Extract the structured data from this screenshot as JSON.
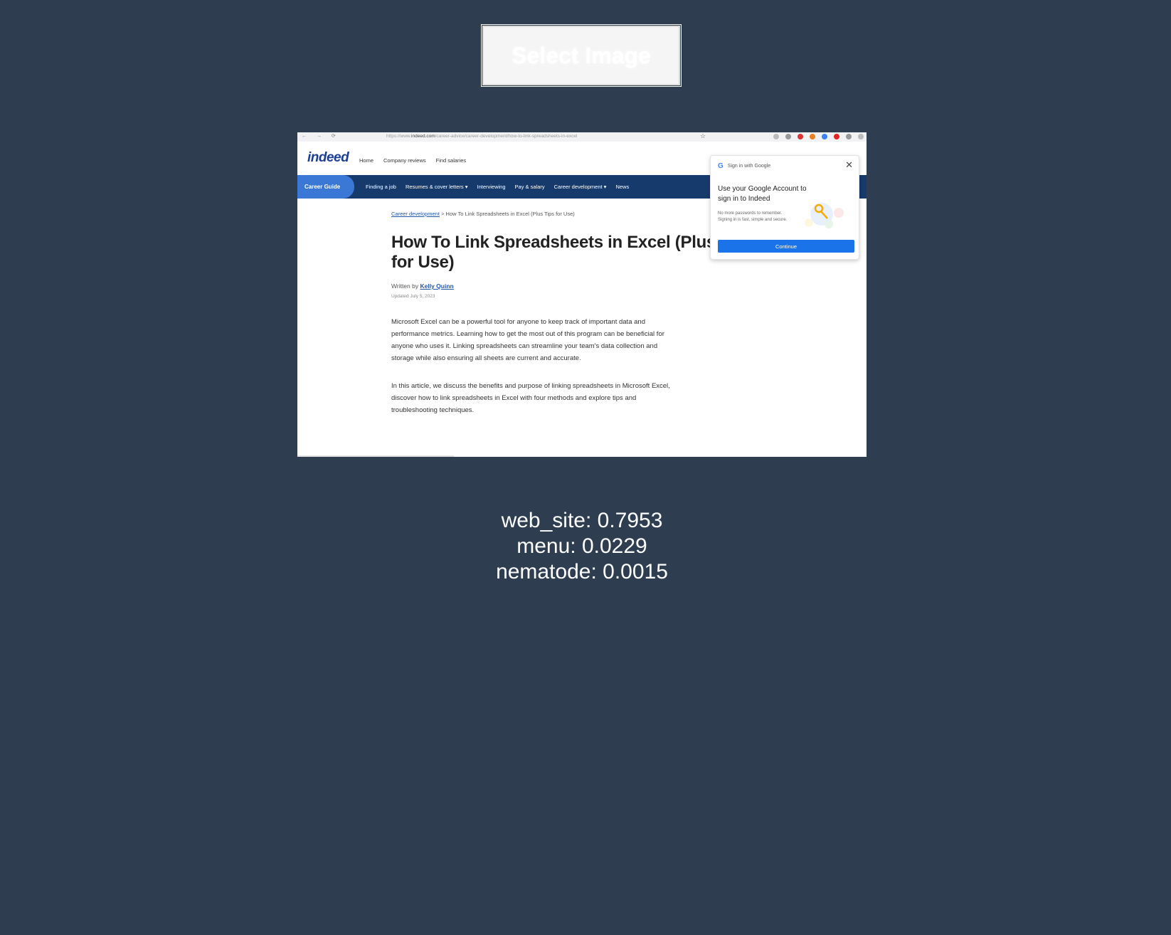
{
  "select_button": {
    "label": "Select Image"
  },
  "preview": {
    "browser": {
      "url_prefix": "https://www.",
      "url_domain": "indeed.com",
      "url_path": "/career-advice/career-development/how-to-link-spreadsheets-in-excel",
      "nav_glyphs": "← → ⟳",
      "star_glyph": "☆"
    },
    "site": {
      "logo": "indeed",
      "top_links": [
        "Home",
        "Company reviews",
        "Find salaries"
      ],
      "career_guide_tab": "Career Guide",
      "nav_links": [
        "Finding a job",
        "Resumes & cover letters ▾",
        "Interviewing",
        "Pay & salary",
        "Career development ▾",
        "News"
      ]
    },
    "article": {
      "breadcrumb_link": "Career development",
      "breadcrumb_sep": ">",
      "breadcrumb_current": "How To Link Spreadsheets in Excel (Plus Tips for Use)",
      "title": "How To Link Spreadsheets in Excel (Plus Tips for Use)",
      "written_by": "Written by",
      "author": "Kelly Quinn",
      "updated": "Updated July 5, 2023",
      "para1": "Microsoft Excel can be a powerful tool for anyone to keep track of important data and performance metrics. Learning how to get the most out of this program can be beneficial for anyone who uses it. Linking spreadsheets can streamline your team's data collection and storage while also ensuring all sheets are current and accurate.",
      "para2": "In this article, we discuss the benefits and purpose of linking spreadsheets in Microsoft Excel, discover how to link spreadsheets in Excel with four methods and explore tips and troubleshooting techniques."
    },
    "google_popup": {
      "header": "Sign in with Google",
      "g_letter": "G",
      "close": "✕",
      "title": "Use your Google Account to sign in to Indeed",
      "subtitle": "No more passwords to remember. Signing in is fast, simple and secure.",
      "button": "Continue"
    }
  },
  "predictions": [
    {
      "text": "web_site: 0.7953"
    },
    {
      "text": "menu: 0.0229"
    },
    {
      "text": "nematode: 0.0015"
    }
  ]
}
